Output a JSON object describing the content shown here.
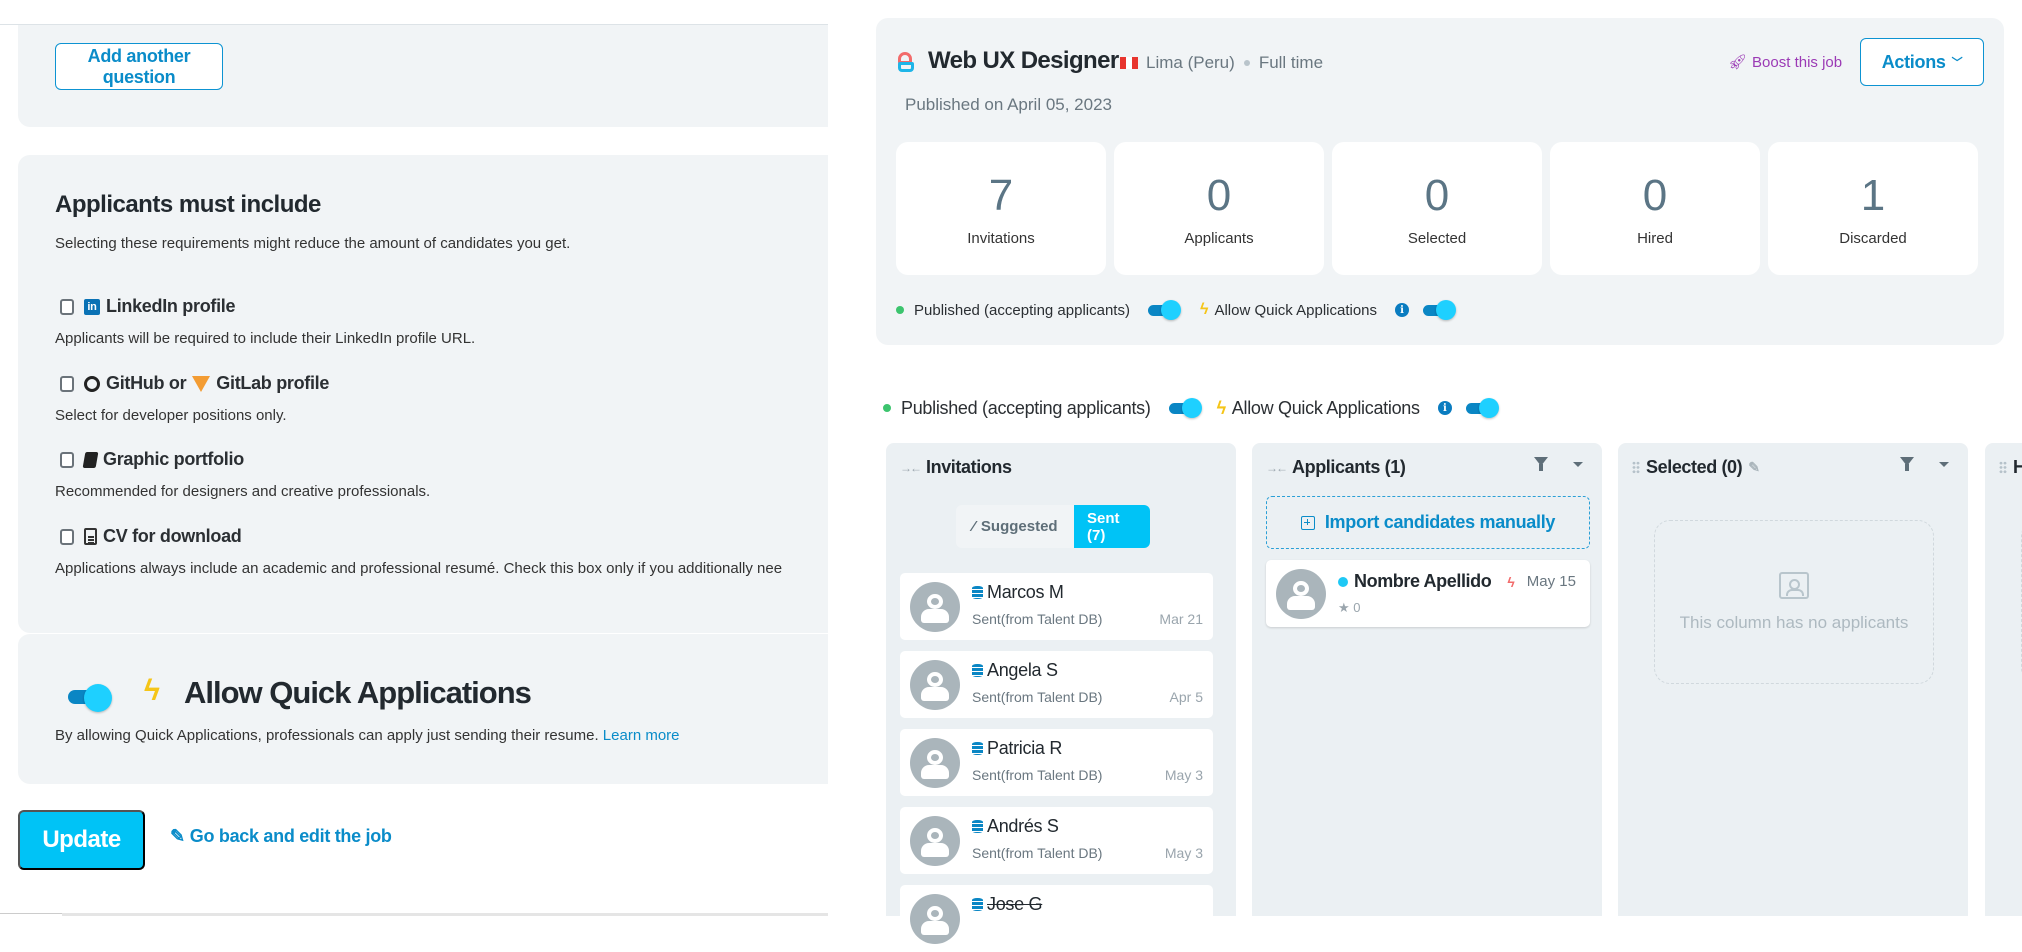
{
  "left": {
    "add_question_label": "Add another question",
    "requirements": {
      "title": "Applicants must include",
      "subtitle": "Selecting these requirements might reduce the amount of candidates you get.",
      "items": [
        {
          "label": "LinkedIn profile",
          "icon": "linkedin-icon",
          "description": "Applicants will be required to include their LinkedIn profile URL.",
          "checked": false
        },
        {
          "label_a": "GitHub or",
          "label_b": "GitLab profile",
          "icon": "github-icon",
          "icon_b": "gitlab-icon",
          "description": "Select for developer positions only.",
          "checked": false
        },
        {
          "label": "Graphic portfolio",
          "icon": "book-icon",
          "description": "Recommended for designers and creative professionals.",
          "checked": false
        },
        {
          "label": "CV for download",
          "icon": "document-icon",
          "description": "Applications always include an academic and professional resumé. Check this box only if you additionally nee",
          "checked": false
        }
      ]
    },
    "quick_apps": {
      "title": "Allow Quick Applications",
      "description": "By allowing Quick Applications, professionals can apply just sending their resume.",
      "learn_more": "Learn more",
      "enabled": true
    },
    "update_label": "Update",
    "go_back_label": "Go back and edit the job"
  },
  "job": {
    "title": "Web UX Designer",
    "location": "Lima (Peru)",
    "type": "Full time",
    "published": "Published on April 05, 2023",
    "boost_label": "Boost this job",
    "actions_label": "Actions",
    "stats": [
      {
        "value": "7",
        "label": "Invitations"
      },
      {
        "value": "0",
        "label": "Applicants"
      },
      {
        "value": "0",
        "label": "Selected"
      },
      {
        "value": "0",
        "label": "Hired"
      },
      {
        "value": "1",
        "label": "Discarded"
      }
    ],
    "status_label": "Published (accepting applicants)",
    "quick_label": "Allow Quick Applications",
    "published_on": true,
    "quick_on": true
  },
  "board": {
    "status_label": "Published (accepting applicants)",
    "quick_label": "Allow Quick Applications",
    "columns": {
      "invitations": {
        "title": "Invitations",
        "tabs": {
          "suggested": "Suggested",
          "sent": "Sent (7)"
        },
        "cards": [
          {
            "name": "Marcos M",
            "source": "Sent(from Talent DB)",
            "date": "Mar 21",
            "struck": false
          },
          {
            "name": "Angela S",
            "source": "Sent(from Talent DB)",
            "date": "Apr 5",
            "struck": false
          },
          {
            "name": "Patricia R",
            "source": "Sent(from Talent DB)",
            "date": "May 3",
            "struck": false
          },
          {
            "name": "Andrés S",
            "source": "Sent(from Talent DB)",
            "date": "May 3",
            "struck": false
          },
          {
            "name": "Jose G",
            "source": "",
            "date": "",
            "struck": true
          }
        ]
      },
      "applicants": {
        "title": "Applicants (1)",
        "import_label": "Import candidates manually",
        "card": {
          "name": "Nombre Apellido",
          "date": "May 15",
          "stars": "0"
        }
      },
      "selected": {
        "title": "Selected (0)",
        "empty_text": "This column has no applicants"
      },
      "hired": {
        "title": "H"
      }
    }
  },
  "colors": {
    "accent": "#00c3f6",
    "link": "#0a8cc9",
    "boost": "#9b3ab5",
    "status_green": "#3cc46e",
    "bolt_yellow": "#f5c518"
  }
}
